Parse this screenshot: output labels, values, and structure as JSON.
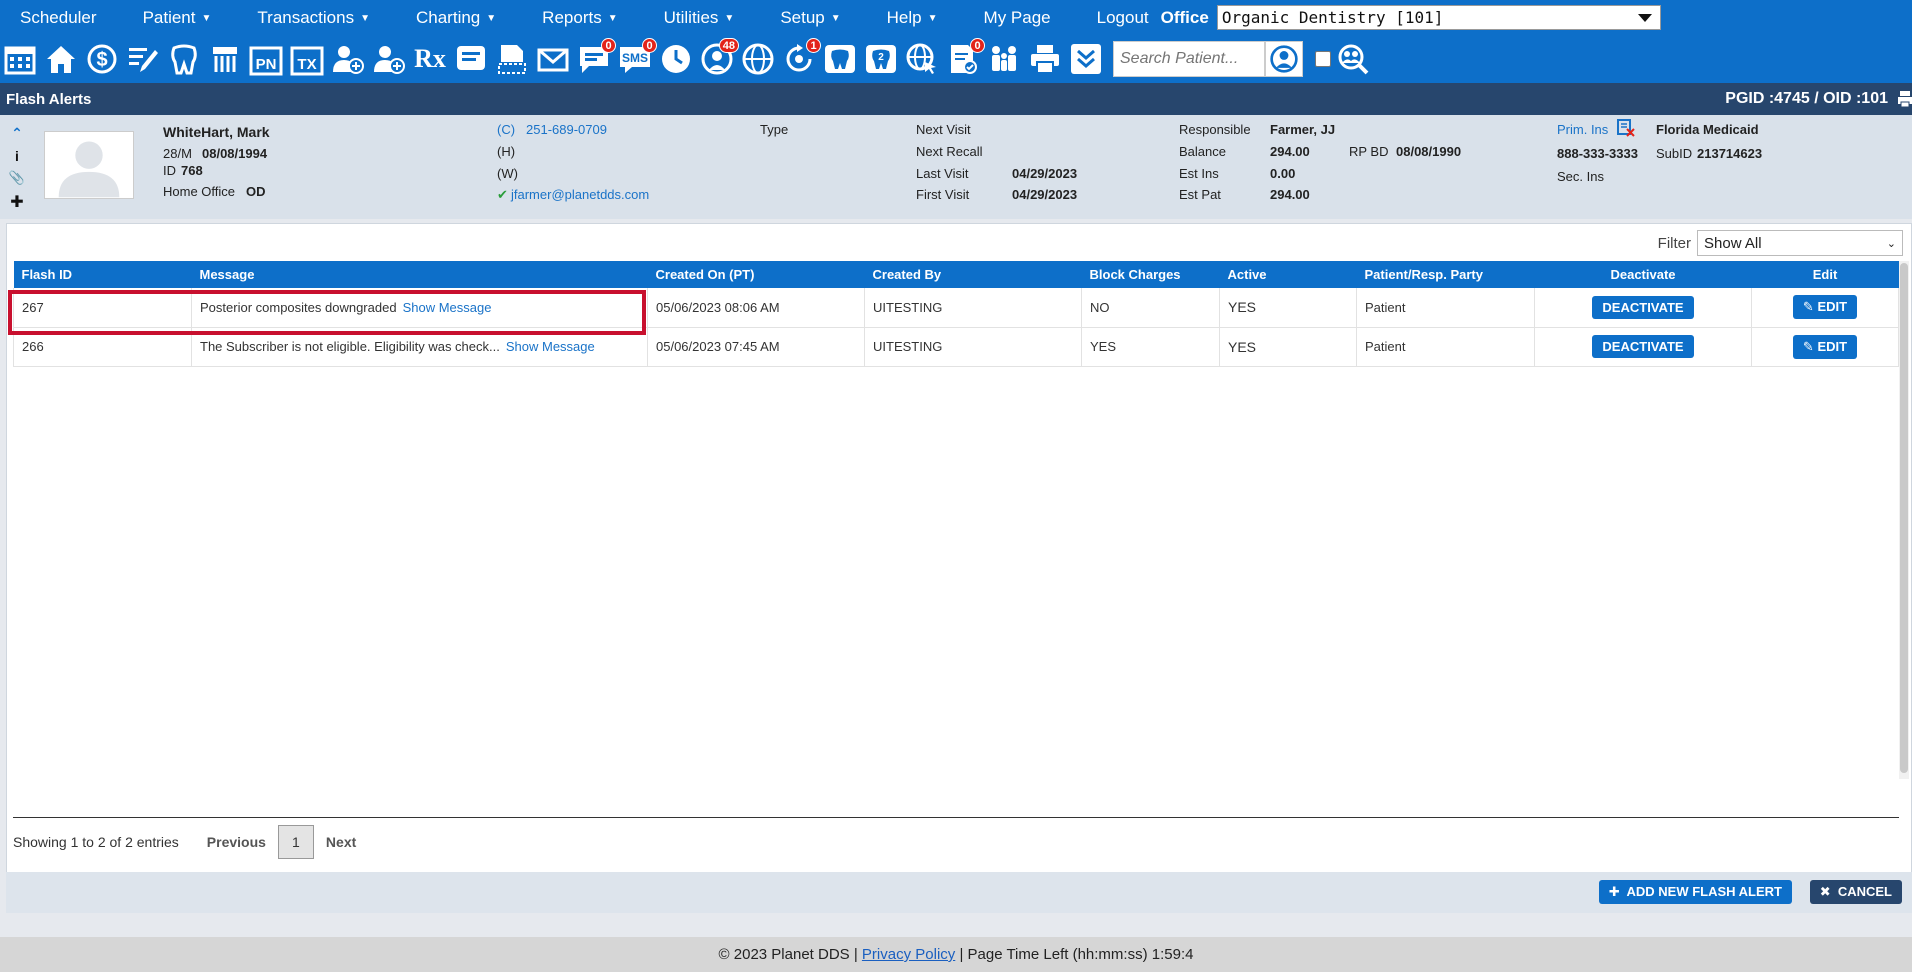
{
  "nav": {
    "items": [
      {
        "label": "Scheduler",
        "caret": false
      },
      {
        "label": "Patient",
        "caret": true
      },
      {
        "label": "Transactions",
        "caret": true
      },
      {
        "label": "Charting",
        "caret": true
      },
      {
        "label": "Reports",
        "caret": true
      },
      {
        "label": "Utilities",
        "caret": true
      },
      {
        "label": "Setup",
        "caret": true
      },
      {
        "label": "Help",
        "caret": true
      },
      {
        "label": "My Page",
        "caret": false
      },
      {
        "label": "Logout",
        "caret": false
      }
    ],
    "office_label": "Office",
    "office_value": "Organic Dentistry [101]"
  },
  "toolbar": {
    "badges": {
      "messages": "0",
      "sms": "0",
      "globe_users": "48",
      "recall": "1",
      "documents": "0"
    },
    "sms_text": "SMS",
    "pn_text": "PN",
    "tx_text": "TX",
    "rx_text": "Rx",
    "search_placeholder": "Search Patient..."
  },
  "header": {
    "title": "Flash Alerts",
    "ids": "PGID :4745  /  OID :101"
  },
  "patient": {
    "name": "WhiteHart, Mark",
    "age_sex": "28/M",
    "dob": "08/08/1994",
    "id_label": "ID",
    "id": "768",
    "home_office_label": "Home Office",
    "home_office": "OD",
    "phone_c_label": "(C)",
    "phone_c": "251-689-0709",
    "phone_h_label": "(H)",
    "phone_w_label": "(W)",
    "email": "jfarmer@planetdds.com",
    "type_label": "Type",
    "next_visit_label": "Next Visit",
    "next_recall_label": "Next Recall",
    "last_visit_label": "Last Visit",
    "last_visit": "04/29/2023",
    "first_visit_label": "First Visit",
    "first_visit": "04/29/2023",
    "responsible_label": "Responsible",
    "responsible": "Farmer, JJ",
    "balance_label": "Balance",
    "balance": "294.00",
    "rp_bd_label": "RP BD",
    "rp_bd": "08/08/1990",
    "est_ins_label": "Est Ins",
    "est_ins": "0.00",
    "est_pat_label": "Est Pat",
    "est_pat": "294.00",
    "prim_ins_label": "Prim. Ins",
    "prim_ins": "Florida Medicaid",
    "ins_phone": "888-333-3333",
    "subid_label": "SubID",
    "subid": "213714623",
    "sec_ins_label": "Sec. Ins"
  },
  "filter": {
    "label": "Filter",
    "value": "Show All"
  },
  "table": {
    "columns": [
      "Flash ID",
      "Message",
      "Created On (PT)",
      "Created By",
      "Block Charges",
      "Active",
      "Patient/Resp. Party",
      "Deactivate",
      "Edit"
    ],
    "rows": [
      {
        "id": "267",
        "message": "Posterior composites downgraded",
        "show": "Show Message",
        "created_on": "05/06/2023 08:06 AM",
        "created_by": "UITESTING",
        "block": "NO",
        "active": "YES",
        "party": "Patient",
        "deactivate": "DEACTIVATE",
        "edit": "EDIT"
      },
      {
        "id": "266",
        "message": "The Subscriber is not eligible. Eligibility was check...",
        "show": "Show Message",
        "created_on": "05/06/2023 07:45 AM",
        "created_by": "UITESTING",
        "block": "YES",
        "active": "YES",
        "party": "Patient",
        "deactivate": "DEACTIVATE",
        "edit": "EDIT"
      }
    ]
  },
  "pager": {
    "info": "Showing 1 to 2 of 2 entries",
    "previous": "Previous",
    "page": "1",
    "next": "Next"
  },
  "actions": {
    "add": "ADD NEW FLASH ALERT",
    "cancel": "CANCEL"
  },
  "footer": {
    "copyright": "© 2023 Planet DDS |",
    "privacy": "Privacy Policy",
    "time_left": "|  Page Time Left (hh:mm:ss) 1:59:4"
  },
  "colors": {
    "nav_blue": "#0d6fc9",
    "header_navy": "#27466d",
    "highlight_red": "#c8102e",
    "badge_red": "#e2231a"
  }
}
